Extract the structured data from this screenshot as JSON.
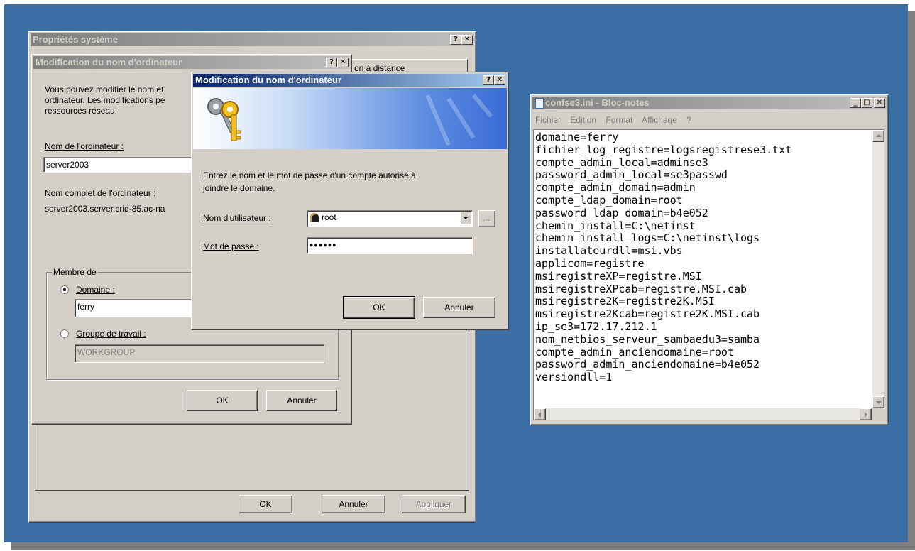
{
  "system_properties": {
    "title": "Propriétés système",
    "partial_tab": "on à distance",
    "ok_label": "OK",
    "cancel_label": "Annuler",
    "apply_label": "Appliquer"
  },
  "computer_name_dialog": {
    "title": "Modification du nom d'ordinateur",
    "description_lines": [
      "Vous pouvez modifier le nom et",
      "ordinateur. Les modifications pe",
      "ressources réseau."
    ],
    "computer_name_label": "Nom de l'ordinateur :",
    "computer_name_value": "server2003",
    "full_name_label": "Nom complet de l'ordinateur :",
    "full_name_value": "server2003.server.crid-85.ac-na",
    "member_of_label": "Membre de",
    "domain_label": "Domaine :",
    "domain_value": "ferry",
    "workgroup_label": "Groupe de travail :",
    "workgroup_value": "WORKGROUP",
    "ok_label": "OK",
    "cancel_label": "Annuler"
  },
  "credentials_dialog": {
    "title": "Modification du nom d'ordinateur",
    "prompt_lines": [
      "Entrez le nom et le mot de passe d'un compte autorisé à",
      "joindre le domaine."
    ],
    "username_label": "Nom d'utilisateur :",
    "username_value": "root",
    "password_label": "Mot de passe :",
    "password_value": "●●●●●●",
    "browse_label": "...",
    "ok_label": "OK",
    "cancel_label": "Annuler"
  },
  "notepad": {
    "title": "confse3.ini - Bloc-notes",
    "menu": [
      "Fichier",
      "Edition",
      "Format",
      "Affichage",
      "?"
    ],
    "lines": [
      "domaine=ferry",
      "fichier_log_registre=logsregistrese3.txt",
      "compte_admin_local=adminse3",
      "password_admin_local=se3passwd",
      "compte_admin_domain=admin",
      "compte_ldap_domain=root",
      "password_ldap_domain=b4e052",
      "chemin_install=C:\\netinst",
      "chemin_install_logs=C:\\netinst\\logs",
      "installateurdll=msi.vbs",
      "applicom=registre",
      "msiregistreXP=registre.MSI",
      "msiregistreXPcab=registre.MSI.cab",
      "msiregistre2K=registre2K.MSI",
      "msiregistre2Kcab=registre2K.MSI.cab",
      "ip_se3=172.17.212.1",
      "nom_netbios_serveur_sambaedu3=samba",
      "compte_admin_anciendomaine=root",
      "password_admin_anciendomaine=b4e052",
      "versiondll=1"
    ]
  }
}
